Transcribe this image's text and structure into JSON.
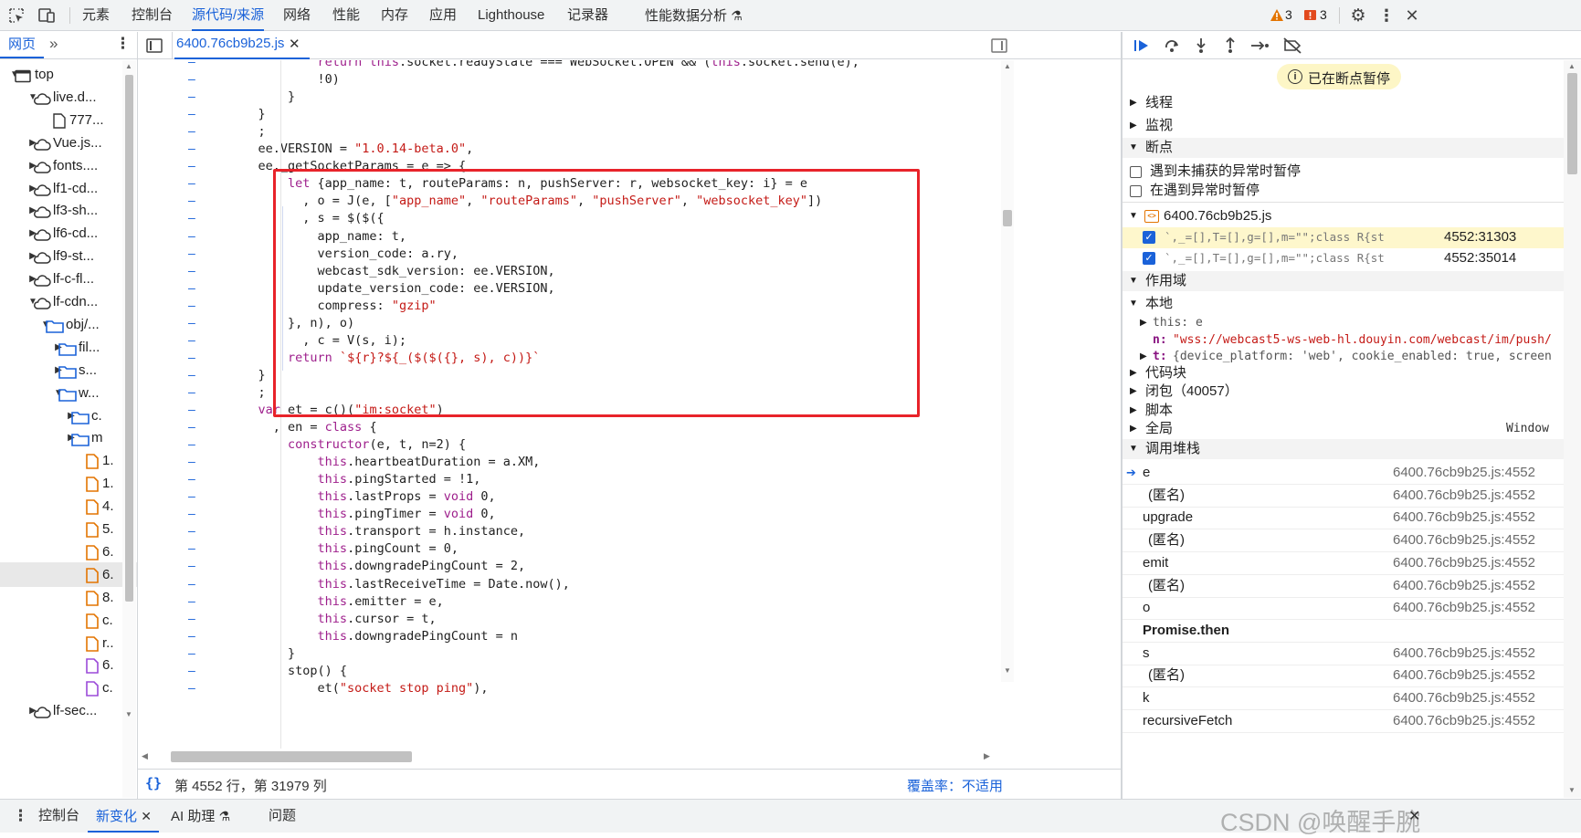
{
  "top_tabs": [
    "元素",
    "控制台",
    "源代码/来源",
    "网络",
    "性能",
    "内存",
    "应用",
    "Lighthouse",
    "记录器",
    "性能数据分析"
  ],
  "active_top_tab": "源代码/来源",
  "warnings_count": "3",
  "errors_count": "3",
  "nav_tab": "网页",
  "file_tab": "6400.76cb9b25.js",
  "tree": [
    {
      "label": "top",
      "type": "frame",
      "expanded": true
    },
    {
      "label": "live.d...",
      "type": "cloud",
      "expanded": true
    },
    {
      "label": "777...",
      "type": "file"
    },
    {
      "label": "Vue.js...",
      "type": "cloud"
    },
    {
      "label": "fonts....",
      "type": "cloud"
    },
    {
      "label": "lf1-cd...",
      "type": "cloud"
    },
    {
      "label": "lf3-sh...",
      "type": "cloud"
    },
    {
      "label": "lf6-cd...",
      "type": "cloud"
    },
    {
      "label": "lf9-st...",
      "type": "cloud"
    },
    {
      "label": "lf-c-fl...",
      "type": "cloud"
    },
    {
      "label": "lf-cdn...",
      "type": "cloud",
      "expanded": true
    },
    {
      "label": "obj/...",
      "type": "folder",
      "expanded": true
    },
    {
      "label": "fil...",
      "type": "folder"
    },
    {
      "label": "s...",
      "type": "folder"
    },
    {
      "label": "w...",
      "type": "folder",
      "expanded": true
    },
    {
      "label": "c.",
      "type": "folder"
    },
    {
      "label": "m",
      "type": "folder"
    },
    {
      "label": "1.",
      "type": "jsfile"
    },
    {
      "label": "1.",
      "type": "jsfile"
    },
    {
      "label": "4.",
      "type": "jsfile"
    },
    {
      "label": "5.",
      "type": "jsfile"
    },
    {
      "label": "6.",
      "type": "jsfile"
    },
    {
      "label": "6.",
      "type": "jsfile",
      "selected": true
    },
    {
      "label": "8.",
      "type": "jsfile"
    },
    {
      "label": "c.",
      "type": "jsfile"
    },
    {
      "label": "r..",
      "type": "jsfile"
    },
    {
      "label": "6.",
      "type": "cssfile"
    },
    {
      "label": "c.",
      "type": "cssfile"
    },
    {
      "label": "lf-sec...",
      "type": "cloud"
    }
  ],
  "code_lines": [
    "            return this.socket.readyState === WebSocket.OPEN && (this.socket.send(e),",
    "            !0)",
    "        }",
    "    }",
    "    ;",
    "    ee.VERSION = \"1.0.14-beta.0\",",
    "    ee._getSocketParams = e => {",
    "        let {app_name: t, routeParams: n, pushServer: r, websocket_key: i} = e",
    "          , o = J(e, [\"app_name\", \"routeParams\", \"pushServer\", \"websocket_key\"])",
    "          , s = $($({",
    "            app_name: t,",
    "            version_code: a.ry,",
    "            webcast_sdk_version: ee.VERSION,",
    "            update_version_code: ee.VERSION,",
    "            compress: \"gzip\"",
    "        }, n), o)",
    "          , c = V(s, i);",
    "        return `${r}?${_($($({}, s), c))}`",
    "    }",
    "    ;",
    "    var et = c()(\"im:socket\")",
    "      , en = class {",
    "        constructor(e, t, n=2) {",
    "            this.heartbeatDuration = a.XM,",
    "            this.pingStarted = !1,",
    "            this.lastProps = void 0,",
    "            this.pingTimer = void 0,",
    "            this.transport = h.instance,",
    "            this.pingCount = 0,",
    "            this.downgradePingCount = 2,",
    "            this.lastReceiveTime = Date.now(),",
    "            this.emitter = e,",
    "            this.cursor = t,",
    "            this.downgradePingCount = n",
    "        }",
    "        stop() {",
    "            et(\"socket stop ping\"),"
  ],
  "status": {
    "position": "第 4552 行，第 31979 列",
    "coverage": "覆盖率：不适用"
  },
  "paused_label": "已在断点暂停",
  "sections": {
    "threads": "线程",
    "watch": "监视",
    "breakpoints": "断点",
    "scope": "作用域",
    "callstack": "调用堆栈"
  },
  "bp_options": [
    "遇到未捕获的异常时暂停",
    "在遇到异常时暂停"
  ],
  "bp_file": "6400.76cb9b25.js",
  "bp_items": [
    {
      "code": "`,_=[],T=[],g=[],m=\"\";class R{static g…",
      "loc": "4552:31303",
      "highlight": true
    },
    {
      "code": "`,_=[],T=[],g=[],m=\"\";class R{static g…",
      "loc": "4552:35014",
      "highlight": false
    }
  ],
  "scope": {
    "local": "本地",
    "this_label": "this: e",
    "n_label": "n:",
    "n_value": "\"wss://webcast5-ws-web-hl.douyin.com/webcast/im/push/",
    "t_label": "t:",
    "t_value": "{device_platform: 'web', cookie_enabled: true, screen",
    "block": "代码块",
    "closure": "闭包（40057）",
    "script": "脚本",
    "global": "全局",
    "global_value": "Window"
  },
  "callstack": [
    {
      "name": "e",
      "loc": "6400.76cb9b25.js:4552",
      "current": true
    },
    {
      "name": "(匿名)",
      "loc": "6400.76cb9b25.js:4552"
    },
    {
      "name": "upgrade",
      "loc": "6400.76cb9b25.js:4552"
    },
    {
      "name": "(匿名)",
      "loc": "6400.76cb9b25.js:4552"
    },
    {
      "name": "emit",
      "loc": "6400.76cb9b25.js:4552"
    },
    {
      "name": "(匿名)",
      "loc": "6400.76cb9b25.js:4552"
    },
    {
      "name": "o",
      "loc": "6400.76cb9b25.js:4552"
    },
    {
      "name": "Promise.then",
      "loc": "",
      "bold": true
    },
    {
      "name": "s",
      "loc": "6400.76cb9b25.js:4552"
    },
    {
      "name": "(匿名)",
      "loc": "6400.76cb9b25.js:4552"
    },
    {
      "name": "k",
      "loc": "6400.76cb9b25.js:4552"
    },
    {
      "name": "recursiveFetch",
      "loc": "6400.76cb9b25.js:4552"
    }
  ],
  "bottom_tabs": [
    "控制台",
    "新变化",
    "AI 助理",
    "问题"
  ],
  "active_bottom_tab": "新变化",
  "watermark": "CSDN @唤醒手腕",
  "colors": {
    "accent": "#1a62d9",
    "highlight_box": "#e8232a",
    "breakpoint_bg": "#fef7cc"
  }
}
